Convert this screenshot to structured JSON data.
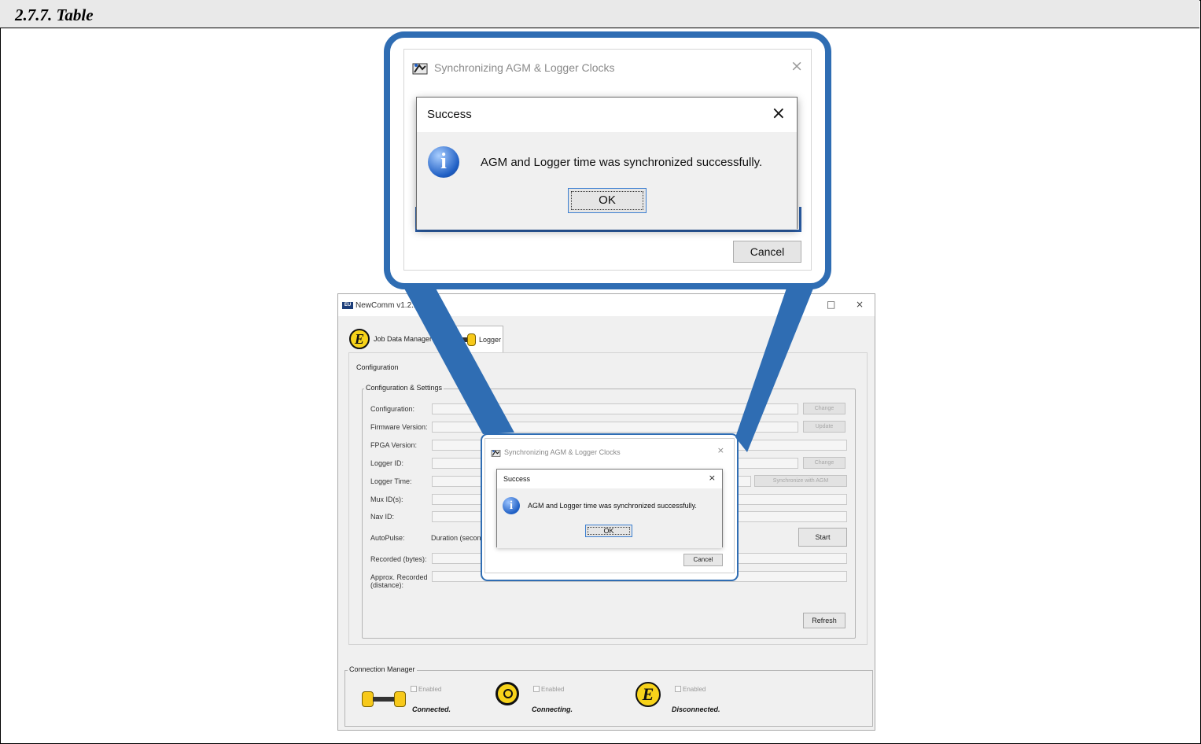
{
  "doc": {
    "heading": "2.7.7. Table"
  },
  "app": {
    "title": "NewComm v1.2.22",
    "icon_text": "EU",
    "window_buttons": {
      "minimize": "–",
      "maximize": "□",
      "close": "×"
    },
    "tabs": [
      {
        "label": "Job Data Manager",
        "icon": "e-logo-icon"
      },
      {
        "label": "Logger",
        "icon": "logger-icon"
      }
    ],
    "e_logo_letter": "E",
    "config_tab": "Configuration",
    "group_title": "Configuration & Settings",
    "rows": {
      "configuration": "Configuration:",
      "firmware": "Firmware Version:",
      "fpga": "FPGA Version:",
      "logger_id": "Logger ID:",
      "logger_time": "Logger Time:",
      "mux_ids": "Mux ID(s):",
      "nav_id": "Nav ID:",
      "autopulse": "AutoPulse:",
      "recorded": "Recorded (bytes):",
      "approx": "Approx. Recorded (distance):"
    },
    "autopulse_duration": "Duration (seconds)",
    "buttons": {
      "change_config": "Change",
      "update_firmware": "Update",
      "change_id": "Change",
      "sync": "Synchronize with AGM",
      "start": "Start",
      "refresh": "Refresh"
    },
    "connection_manager": {
      "title": "Connection Manager",
      "items": [
        {
          "enabled": "Enabled",
          "status": "Connected.",
          "icon": "logger-icon"
        },
        {
          "enabled": "Enabled",
          "status": "Connecting.",
          "icon": "signal-icon"
        },
        {
          "enabled": "Enabled",
          "status": "Disconnected.",
          "icon": "e-logo-icon"
        }
      ]
    }
  },
  "dialog": {
    "title": "Synchronizing AGM & Logger Clocks",
    "close": "×",
    "cancel": "Cancel",
    "message_box": {
      "title": "Success",
      "close": "×",
      "info_glyph": "i",
      "message": "AGM and Logger time was synchronized successfully.",
      "ok": "OK"
    }
  },
  "colors": {
    "callout_border": "#2f6db3",
    "info_blue": "#1f5fc4",
    "logo_yellow": "#f7d31a"
  }
}
